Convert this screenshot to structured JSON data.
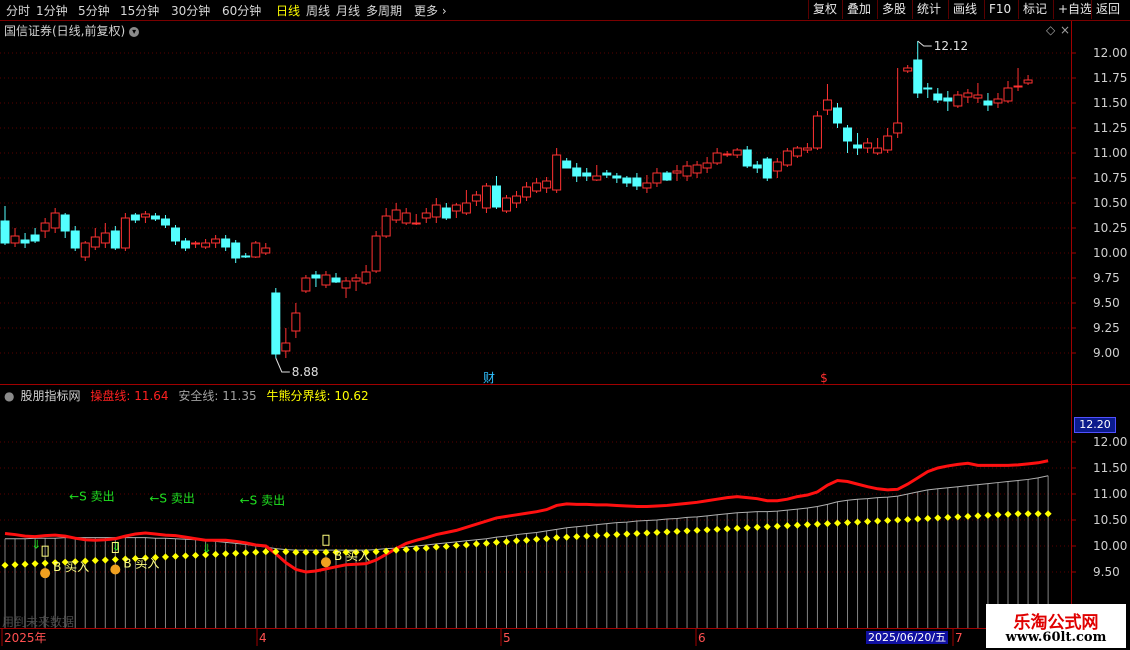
{
  "toolbar": {
    "periods": [
      "分时",
      "1分钟",
      "5分钟",
      "15分钟",
      "30分钟",
      "60分钟",
      "日线",
      "周线",
      "月线",
      "多周期",
      "更多"
    ],
    "active_period": "日线",
    "right_buttons": [
      "复权",
      "叠加",
      "多股",
      "统计",
      "画线",
      "F10",
      "标记",
      "+自选",
      "返回"
    ]
  },
  "main_panel": {
    "title": "国信证券(日线,前复权)",
    "high_label": "12.12",
    "low_label": "8.88",
    "markers": {
      "financial": "财",
      "dividend": "$"
    }
  },
  "indicator_panel": {
    "name": "股朋指标网",
    "lines": [
      {
        "label": "操盘线:",
        "value": "11.64",
        "color": "#ff2020"
      },
      {
        "label": "安全线:",
        "value": "11.35",
        "color": "#a0a0a0"
      },
      {
        "label": "牛熊分界线:",
        "value": "10.62",
        "color": "#ffff00"
      }
    ],
    "signal_text": {
      "sell": "←S 卖出",
      "buy": "B 买入"
    },
    "current_price": "12.20",
    "future_note": "用到未来数据"
  },
  "x_axis": {
    "labels": [
      "2025年",
      "4",
      "5",
      "6",
      "7"
    ],
    "cursor_date": "2025/06/20/五"
  },
  "watermark": {
    "title": "乐淘公式网",
    "url": "www.60lt.com"
  },
  "colors": {
    "up": "#ff3232",
    "down": "#54ffff",
    "ma_red": "#ff1010",
    "safety": "#b0b0b0",
    "bull_bear": "#ffff00",
    "grid": "#5a0000"
  },
  "chart_data": [
    {
      "type": "candlestick",
      "title": "国信证券(日线,前复权)",
      "ylim": [
        8.7,
        12.2
      ],
      "y_ticks": [
        9.0,
        9.25,
        9.5,
        9.75,
        10.0,
        10.25,
        10.5,
        10.75,
        11.0,
        11.25,
        11.5,
        11.75,
        12.0
      ],
      "candles": [
        [
          10.32,
          10.1,
          10.47,
          10.08
        ],
        [
          10.1,
          10.17,
          10.25,
          10.06
        ],
        [
          10.13,
          10.1,
          10.2,
          10.05
        ],
        [
          10.18,
          10.12,
          10.25,
          10.1
        ],
        [
          10.22,
          10.3,
          10.35,
          10.15
        ],
        [
          10.25,
          10.4,
          10.45,
          10.2
        ],
        [
          10.38,
          10.22,
          10.4,
          10.15
        ],
        [
          10.22,
          10.05,
          10.27,
          10.02
        ],
        [
          9.96,
          10.1,
          10.12,
          9.92
        ],
        [
          10.06,
          10.16,
          10.25,
          10.03
        ],
        [
          10.1,
          10.2,
          10.3,
          10.05
        ],
        [
          10.22,
          10.05,
          10.27,
          10.03
        ],
        [
          10.05,
          10.35,
          10.4,
          10.02
        ],
        [
          10.38,
          10.33,
          10.4,
          10.3
        ],
        [
          10.36,
          10.39,
          10.42,
          10.3
        ],
        [
          10.37,
          10.34,
          10.4,
          10.32
        ],
        [
          10.34,
          10.28,
          10.38,
          10.25
        ],
        [
          10.25,
          10.12,
          10.28,
          10.08
        ],
        [
          10.12,
          10.05,
          10.15,
          10.02
        ],
        [
          10.09,
          10.1,
          10.12,
          10.05
        ],
        [
          10.06,
          10.1,
          10.14,
          10.04
        ],
        [
          10.1,
          10.14,
          10.18,
          10.05
        ],
        [
          10.14,
          10.06,
          10.18,
          10.02
        ],
        [
          10.1,
          9.95,
          10.13,
          9.9
        ],
        [
          9.97,
          9.96,
          10.0,
          9.95
        ],
        [
          9.96,
          10.1,
          10.12,
          9.95
        ],
        [
          10.0,
          10.05,
          10.1,
          9.98
        ],
        [
          9.6,
          8.99,
          9.65,
          8.95
        ],
        [
          9.02,
          9.1,
          9.25,
          8.95
        ],
        [
          9.22,
          9.4,
          9.5,
          9.15
        ],
        [
          9.62,
          9.75,
          9.78,
          9.6
        ],
        [
          9.78,
          9.75,
          9.82,
          9.66
        ],
        [
          9.68,
          9.78,
          9.82,
          9.65
        ],
        [
          9.75,
          9.71,
          9.8,
          9.7
        ],
        [
          9.65,
          9.72,
          9.76,
          9.55
        ],
        [
          9.72,
          9.75,
          9.79,
          9.62
        ],
        [
          9.7,
          9.81,
          9.88,
          9.68
        ],
        [
          9.82,
          10.17,
          10.22,
          9.8
        ],
        [
          10.17,
          10.37,
          10.45,
          10.15
        ],
        [
          10.33,
          10.43,
          10.5,
          10.3
        ],
        [
          10.3,
          10.4,
          10.45,
          10.28
        ],
        [
          10.3,
          10.3,
          10.39,
          10.28
        ],
        [
          10.35,
          10.4,
          10.45,
          10.3
        ],
        [
          10.36,
          10.48,
          10.55,
          10.3
        ],
        [
          10.45,
          10.35,
          10.5,
          10.33
        ],
        [
          10.42,
          10.48,
          10.5,
          10.35
        ],
        [
          10.4,
          10.5,
          10.63,
          10.38
        ],
        [
          10.52,
          10.58,
          10.62,
          10.47
        ],
        [
          10.45,
          10.67,
          10.7,
          10.4
        ],
        [
          10.67,
          10.46,
          10.77,
          10.44
        ],
        [
          10.42,
          10.55,
          10.58,
          10.4
        ],
        [
          10.5,
          10.57,
          10.62,
          10.45
        ],
        [
          10.56,
          10.66,
          10.71,
          10.52
        ],
        [
          10.62,
          10.7,
          10.75,
          10.6
        ],
        [
          10.65,
          10.72,
          10.76,
          10.6
        ],
        [
          10.63,
          10.98,
          11.05,
          10.6
        ],
        [
          10.92,
          10.85,
          10.95,
          10.85
        ],
        [
          10.85,
          10.77,
          10.9,
          10.71
        ],
        [
          10.8,
          10.77,
          10.85,
          10.72
        ],
        [
          10.73,
          10.77,
          10.88,
          10.72
        ],
        [
          10.8,
          10.78,
          10.83,
          10.75
        ],
        [
          10.77,
          10.75,
          10.8,
          10.7
        ],
        [
          10.75,
          10.7,
          10.77,
          10.66
        ],
        [
          10.75,
          10.67,
          10.8,
          10.63
        ],
        [
          10.65,
          10.7,
          10.78,
          10.6
        ],
        [
          10.7,
          10.8,
          10.85,
          10.66
        ],
        [
          10.8,
          10.73,
          10.82,
          10.72
        ],
        [
          10.8,
          10.82,
          10.88,
          10.72
        ],
        [
          10.77,
          10.87,
          10.92,
          10.72
        ],
        [
          10.8,
          10.88,
          10.92,
          10.75
        ],
        [
          10.85,
          10.9,
          10.96,
          10.8
        ],
        [
          10.9,
          11.0,
          11.05,
          10.88
        ],
        [
          10.98,
          10.99,
          11.02,
          10.96
        ],
        [
          10.98,
          11.03,
          11.05,
          10.95
        ],
        [
          11.03,
          10.87,
          11.07,
          10.85
        ],
        [
          10.88,
          10.85,
          10.92,
          10.8
        ],
        [
          10.94,
          10.75,
          10.96,
          10.72
        ],
        [
          10.82,
          10.91,
          10.95,
          10.75
        ],
        [
          10.88,
          11.02,
          11.05,
          10.86
        ],
        [
          10.97,
          11.05,
          11.07,
          10.95
        ],
        [
          11.03,
          11.05,
          11.1,
          11.0
        ],
        [
          11.05,
          11.37,
          11.42,
          11.03
        ],
        [
          11.43,
          11.53,
          11.69,
          11.38
        ],
        [
          11.45,
          11.3,
          11.5,
          11.25
        ],
        [
          11.25,
          11.12,
          11.28,
          11.0
        ],
        [
          11.08,
          11.05,
          11.2,
          10.98
        ],
        [
          11.05,
          11.1,
          11.15,
          11.0
        ],
        [
          11.0,
          11.05,
          11.15,
          10.98
        ],
        [
          11.03,
          11.17,
          11.25,
          11.0
        ],
        [
          11.2,
          11.3,
          11.85,
          11.15
        ],
        [
          11.82,
          11.85,
          11.88,
          11.8
        ],
        [
          11.93,
          11.6,
          12.12,
          11.55
        ],
        [
          11.65,
          11.64,
          11.7,
          11.55
        ],
        [
          11.59,
          11.53,
          11.65,
          11.5
        ],
        [
          11.55,
          11.52,
          11.62,
          11.42
        ],
        [
          11.47,
          11.58,
          11.62,
          11.45
        ],
        [
          11.56,
          11.6,
          11.64,
          11.5
        ],
        [
          11.55,
          11.58,
          11.7,
          11.5
        ],
        [
          11.52,
          11.48,
          11.6,
          11.42
        ],
        [
          11.5,
          11.54,
          11.6,
          11.45
        ],
        [
          11.52,
          11.65,
          11.72,
          11.5
        ],
        [
          11.66,
          11.67,
          11.85,
          11.62
        ],
        [
          11.7,
          11.73,
          11.78,
          11.68
        ]
      ]
    },
    {
      "type": "line",
      "title": "股朋指标网",
      "ylim": [
        9.1,
        12.3
      ],
      "y_ticks": [
        9.5,
        10.0,
        10.5,
        11.0,
        11.5,
        12.0
      ],
      "series": [
        {
          "name": "操盘线",
          "values": [
            10.24,
            10.22,
            10.19,
            10.18,
            10.2,
            10.21,
            10.19,
            10.15,
            10.12,
            10.11,
            10.12,
            10.14,
            10.19,
            10.23,
            10.25,
            10.23,
            10.21,
            10.2,
            10.17,
            10.14,
            10.11,
            10.11,
            10.11,
            10.09,
            10.06,
            10.02,
            10.0,
            9.85,
            9.68,
            9.55,
            9.5,
            9.52,
            9.56,
            9.6,
            9.64,
            9.65,
            9.66,
            9.73,
            9.84,
            9.95,
            10.05,
            10.11,
            10.16,
            10.22,
            10.26,
            10.3,
            10.36,
            10.42,
            10.48,
            10.54,
            10.57,
            10.6,
            10.63,
            10.66,
            10.7,
            10.78,
            10.81,
            10.8,
            10.8,
            10.79,
            10.79,
            10.78,
            10.77,
            10.76,
            10.76,
            10.77,
            10.78,
            10.8,
            10.82,
            10.84,
            10.87,
            10.9,
            10.93,
            10.95,
            10.93,
            10.91,
            10.87,
            10.87,
            10.9,
            10.95,
            10.98,
            11.04,
            11.17,
            11.26,
            11.24,
            11.19,
            11.14,
            11.1,
            11.08,
            11.09,
            11.19,
            11.31,
            11.43,
            11.5,
            11.54,
            11.57,
            11.59,
            11.55,
            11.55,
            11.55,
            11.55,
            11.56,
            11.58,
            11.6,
            11.64
          ]
        },
        {
          "name": "安全线",
          "values": [
            10.14,
            10.14,
            10.14,
            10.15,
            10.15,
            10.15,
            10.16,
            10.16,
            10.16,
            10.16,
            10.16,
            10.16,
            10.16,
            10.16,
            10.16,
            10.15,
            10.15,
            10.14,
            10.13,
            10.12,
            10.11,
            10.09,
            10.07,
            10.05,
            10.03,
            10.0,
            9.98,
            9.95,
            9.93,
            9.92,
            9.92,
            9.92,
            9.92,
            9.92,
            9.92,
            9.92,
            9.92,
            9.93,
            9.95,
            9.96,
            9.98,
            10.0,
            10.02,
            10.04,
            10.06,
            10.08,
            10.1,
            10.12,
            10.14,
            10.17,
            10.19,
            10.22,
            10.24,
            10.26,
            10.29,
            10.32,
            10.35,
            10.37,
            10.39,
            10.41,
            10.43,
            10.45,
            10.46,
            10.48,
            10.49,
            10.5,
            10.52,
            10.53,
            10.55,
            10.56,
            10.58,
            10.6,
            10.62,
            10.64,
            10.65,
            10.66,
            10.66,
            10.67,
            10.69,
            10.71,
            10.73,
            10.76,
            10.8,
            10.85,
            10.88,
            10.9,
            10.91,
            10.93,
            10.94,
            10.96,
            11.0,
            11.04,
            11.08,
            11.1,
            11.12,
            11.14,
            11.16,
            11.18,
            11.2,
            11.22,
            11.24,
            11.26,
            11.28,
            11.31,
            11.35
          ]
        },
        {
          "name": "牛熊分界线",
          "values": [
            9.63,
            9.64,
            9.65,
            9.66,
            9.67,
            9.68,
            9.69,
            9.7,
            9.71,
            9.72,
            9.73,
            9.74,
            9.75,
            9.76,
            9.77,
            9.78,
            9.79,
            9.8,
            9.81,
            9.82,
            9.83,
            9.84,
            9.85,
            9.86,
            9.87,
            9.88,
            9.89,
            9.89,
            9.89,
            9.88,
            9.88,
            9.88,
            9.88,
            9.88,
            9.88,
            9.88,
            9.88,
            9.89,
            9.9,
            9.92,
            9.93,
            9.95,
            9.96,
            9.98,
            9.99,
            10.01,
            10.02,
            10.04,
            10.05,
            10.07,
            10.08,
            10.1,
            10.11,
            10.13,
            10.14,
            10.16,
            10.17,
            10.18,
            10.19,
            10.2,
            10.21,
            10.22,
            10.23,
            10.24,
            10.25,
            10.26,
            10.27,
            10.28,
            10.29,
            10.3,
            10.31,
            10.32,
            10.33,
            10.34,
            10.35,
            10.36,
            10.37,
            10.38,
            10.39,
            10.4,
            10.41,
            10.42,
            10.43,
            10.44,
            10.45,
            10.46,
            10.47,
            10.48,
            10.49,
            10.5,
            10.51,
            10.52,
            10.53,
            10.54,
            10.55,
            10.56,
            10.57,
            10.58,
            10.59,
            10.6,
            10.61,
            10.62,
            10.62,
            10.62,
            10.62
          ]
        }
      ],
      "signals": [
        {
          "type": "sell",
          "index": 3
        },
        {
          "type": "sell",
          "index": 11
        },
        {
          "type": "sell",
          "index": 20
        },
        {
          "type": "buy",
          "index": 4
        },
        {
          "type": "buy",
          "index": 11
        },
        {
          "type": "buy",
          "index": 32
        }
      ]
    }
  ]
}
